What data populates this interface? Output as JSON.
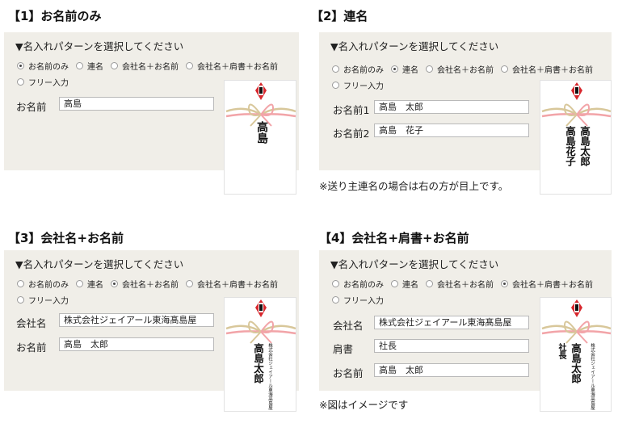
{
  "s1": {
    "title": "【1】お名前のみ",
    "heading": "▼名入れパターンを選択してください",
    "options": [
      "お名前のみ",
      "連名",
      "会社名＋お名前",
      "会社名＋肩書＋お名前"
    ],
    "option5": "フリー入力",
    "selected": 0,
    "label": "お名前",
    "value": "高島",
    "card": "高島"
  },
  "s2": {
    "title": "【2】連名",
    "heading": "▼名入れパターンを選択してください",
    "options": [
      "お名前のみ",
      "連名",
      "会社名＋お名前",
      "会社名＋肩書＋お名前"
    ],
    "option5": "フリー入力",
    "selected": 1,
    "label1": "お名前1",
    "value1": "高島　太郎",
    "label2": "お名前2",
    "value2": "高島　花子",
    "card1": "高島太郎",
    "card2": "高島花子",
    "note": "※送り主連名の場合は右の方が目上です。"
  },
  "s3": {
    "title": "【3】会社名+お名前",
    "heading": "▼名入れパターンを選択してください",
    "options": [
      "お名前のみ",
      "連名",
      "会社名＋お名前",
      "会社名＋肩書＋お名前"
    ],
    "option5": "フリー入力",
    "selected": 2,
    "label_company": "会社名",
    "value_company": "株式会社ジェイアール東海髙島屋",
    "label_name": "お名前",
    "value_name": "高島　太郎",
    "card_company": "株式会社ジェイアール東海髙島屋",
    "card_name": "高島太郎"
  },
  "s4": {
    "title": "【4】会社名+肩書+お名前",
    "heading": "▼名入れパターンを選択してください",
    "options": [
      "お名前のみ",
      "連名",
      "会社名＋お名前",
      "会社名＋肩書＋お名前"
    ],
    "option5": "フリー入力",
    "selected": 3,
    "label_company": "会社名",
    "value_company": "株式会社ジェイアール東海髙島屋",
    "label_title": "肩書",
    "value_title": "社長",
    "label_name": "お名前",
    "value_name": "高島　太郎",
    "card_company": "株式会社ジェイアール東海髙島屋",
    "card_title": "社長",
    "card_name": "高島太郎",
    "note": "※図はイメージです"
  },
  "colors": {
    "panel_bg": "#f0eee8",
    "noshi_red": "#d8262c",
    "ribbon_pink": "#f2a4a8",
    "ribbon_gold": "#d8c79a"
  }
}
